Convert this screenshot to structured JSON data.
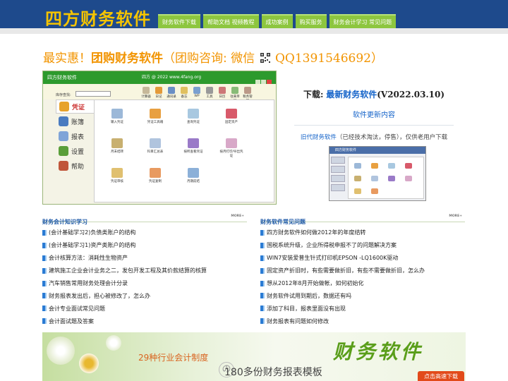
{
  "header": {
    "logo": "四方财务软件",
    "nav": [
      "财务软件下载",
      "帮助文档  视频教程",
      "成功案例",
      "购买服务",
      "财务会计学习  常见问题"
    ]
  },
  "headline": {
    "prefix": "最实惠！",
    "product": "团购财务软件",
    "consult": "（团购咨询: 微信",
    "qq": "QQ1391546692）"
  },
  "app_shot": {
    "title": "四方财务软件",
    "version": "四方 @ 2022 www.4fang.org",
    "find_label": "库存查找:",
    "tools": [
      "计算器",
      "日记",
      "通讯录",
      "备忘",
      "WP",
      "工具",
      "日历",
      "往来单据",
      "税务管理"
    ],
    "sidebar": [
      "凭证",
      "账簿",
      "报表",
      "设置",
      "帮助"
    ],
    "icons": [
      "输入凭证",
      "凭证工具箱",
      "查询凭证",
      "固定资产",
      "月末结转",
      "科目汇总表",
      "按所查看凭证",
      "按月打印/导出凭证",
      "凭证审核",
      "凭证复制",
      "月期前结"
    ]
  },
  "download": {
    "label": "下载:",
    "link": "最新财务软件",
    "version": "(V2022.03.10)",
    "update": "软件更新内容",
    "old_link": "旧代财务软件",
    "old_note": "（已经技术淘汰，停售），仅供老用户下载",
    "mini_title": "四方财务软件"
  },
  "learning": {
    "title": "财务会计知识学习",
    "more": "MORE+",
    "items": [
      "(会计基础学习2)负债类账户的结构",
      "(会计基础学习1)资产类账户的结构",
      "会计核算方法：消耗性生物资产",
      "建筑施工企业会计业务之二，发包开发工程及其价款结算的核算",
      "汽车销售常用财务处理会计分录",
      "财务报表发出后，担心被修改了，怎么办",
      "会计专业面试常见问题",
      "会计面试题及答案"
    ]
  },
  "faq": {
    "title": "财务软件常见问题",
    "more": "MORE+",
    "items": [
      "四方财务软件如何做2012年的年度结转",
      "国税系统升级，企业所得税申报不了的问题解决方案",
      "WIN7安装爱普生针式打印机EPSON -LQ1600K驱动",
      "固定资产折旧时，有些需要做折旧，有些不需要做折旧，怎么办",
      "想从2012年8月开始做帐，如何初始化",
      "财务软件试用到期后，数据还有吗",
      "添加了科目，报表里面没有出现",
      "财务报表有问题如何修改"
    ]
  },
  "banner": {
    "line1": "29种行业会计制度",
    "circle": "の",
    "line2": "180多份财务报表模板",
    "big": "财务软件",
    "button": "点击高速下载"
  },
  "colors": {
    "brand": "#1e4a8c",
    "logo": "#f5c400",
    "accent": "#f29400",
    "nav": "#8dc63f",
    "link": "#1463c9"
  }
}
